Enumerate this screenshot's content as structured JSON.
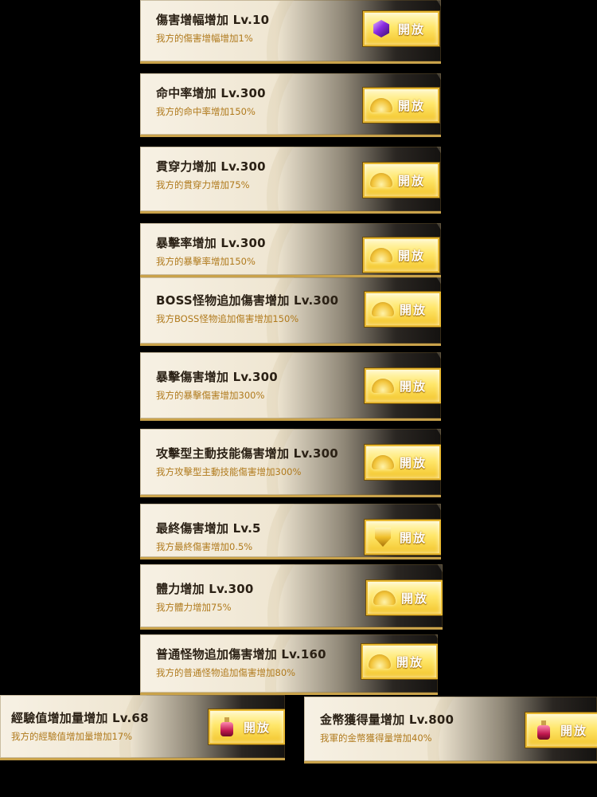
{
  "open_label": "開放",
  "skills": [
    {
      "title": "傷害增幅增加 Lv.10",
      "desc": "我方的傷害增幅增加1%",
      "icon": "gem-icon"
    },
    {
      "title": "命中率增加 Lv.300",
      "desc": "我方的命中率增加150%",
      "icon": "gold-pile-icon"
    },
    {
      "title": "貫穿力增加 Lv.300",
      "desc": "我方的貫穿力增加75%",
      "icon": "gold-pile-icon"
    },
    {
      "title": "暴擊率增加 Lv.300",
      "desc": "我方的暴擊率增加150%",
      "icon": "gold-pile-icon"
    },
    {
      "title": "BOSS怪物追加傷害增加 Lv.300",
      "desc": "我方BOSS怪物追加傷害增加150%",
      "icon": "gold-pile-icon"
    },
    {
      "title": "暴擊傷害增加 Lv.300",
      "desc": "我方的暴擊傷害增加300%",
      "icon": "gold-pile-icon"
    },
    {
      "title": "攻擊型主動技能傷害增加 Lv.300",
      "desc": "我方攻擊型主動技能傷害增加300%",
      "icon": "gold-pile-icon"
    },
    {
      "title": "最終傷害增加 Lv.5",
      "desc": "我方最終傷害增加0.5%",
      "icon": "shield-icon"
    },
    {
      "title": "體力增加 Lv.300",
      "desc": "我方體力增加75%",
      "icon": "gold-pile-icon"
    },
    {
      "title": "普通怪物追加傷害增加 Lv.160",
      "desc": "我方的普通怪物追加傷害增加80%",
      "icon": "gold-pile-icon"
    },
    {
      "title": "經驗值增加量增加 Lv.68",
      "desc": "我方的經驗值增加量增加17%",
      "icon": "potion-icon"
    },
    {
      "title": "金幣獲得量增加 Lv.800",
      "desc": "我軍的金幣獲得量增加40%",
      "icon": "potion-icon"
    }
  ]
}
